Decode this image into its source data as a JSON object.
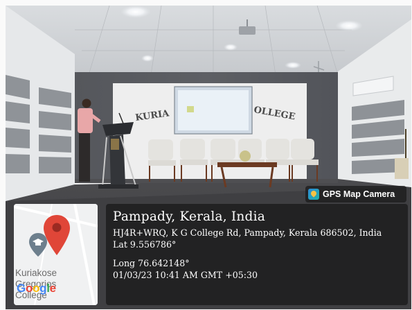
{
  "badge": {
    "icon": "map-camera-icon",
    "label": "GPS Map Camera"
  },
  "banners": {
    "left": "KURIA",
    "right": "OLLEGE"
  },
  "location": {
    "title": "Pampady, Kerala, India",
    "address": "HJ4R+WRQ, K G College Rd, Pampady, Kerala 686502, India",
    "latitude": "Lat 9.556786°",
    "longitude": "Long 76.642148°",
    "timestamp": "01/03/23 10:41 AM GMT +05:30"
  },
  "mini_map": {
    "labels": [
      "Kuriakose",
      "Gregorios",
      "College"
    ],
    "logo": [
      "G",
      "o",
      "o",
      "g",
      "l",
      "e"
    ],
    "logo_colors": [
      "#4285f4",
      "#ea4335",
      "#fbbc05",
      "#4285f4",
      "#34a853",
      "#ea4335"
    ],
    "pin_color": "#e04638",
    "place_icon": "school-pin-icon"
  }
}
